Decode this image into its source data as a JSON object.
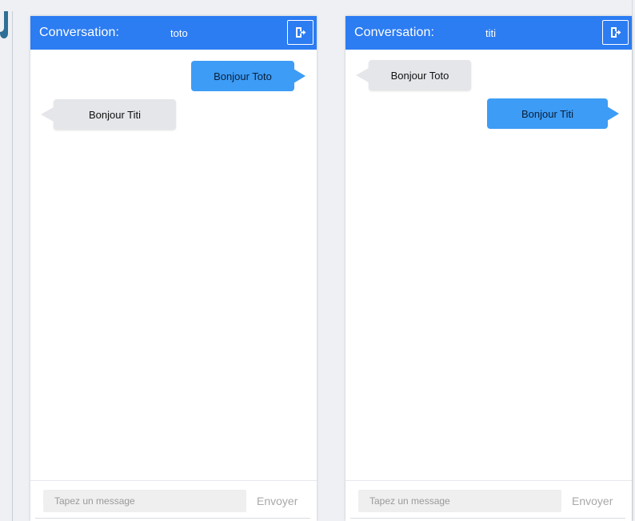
{
  "colors": {
    "header": "#2c7cf2",
    "sent_bubble": "#3d9cf5",
    "received_bubble": "#e5e6ea",
    "background": "#eef0f4"
  },
  "chats": [
    {
      "header_label": "Conversation:",
      "name": "toto",
      "logout_icon": "logout-icon",
      "messages": [
        {
          "text": "Bonjour Toto",
          "direction": "sent"
        },
        {
          "text": "Bonjour Titi",
          "direction": "received"
        }
      ],
      "input_placeholder": "Tapez un message",
      "input_value": "",
      "send_label": "Envoyer"
    },
    {
      "header_label": "Conversation:",
      "name": "titi",
      "logout_icon": "logout-icon",
      "messages": [
        {
          "text": "Bonjour Toto",
          "direction": "received"
        },
        {
          "text": "Bonjour Titi",
          "direction": "sent"
        }
      ],
      "input_placeholder": "Tapez un message",
      "input_value": "",
      "send_label": "Envoyer"
    }
  ]
}
